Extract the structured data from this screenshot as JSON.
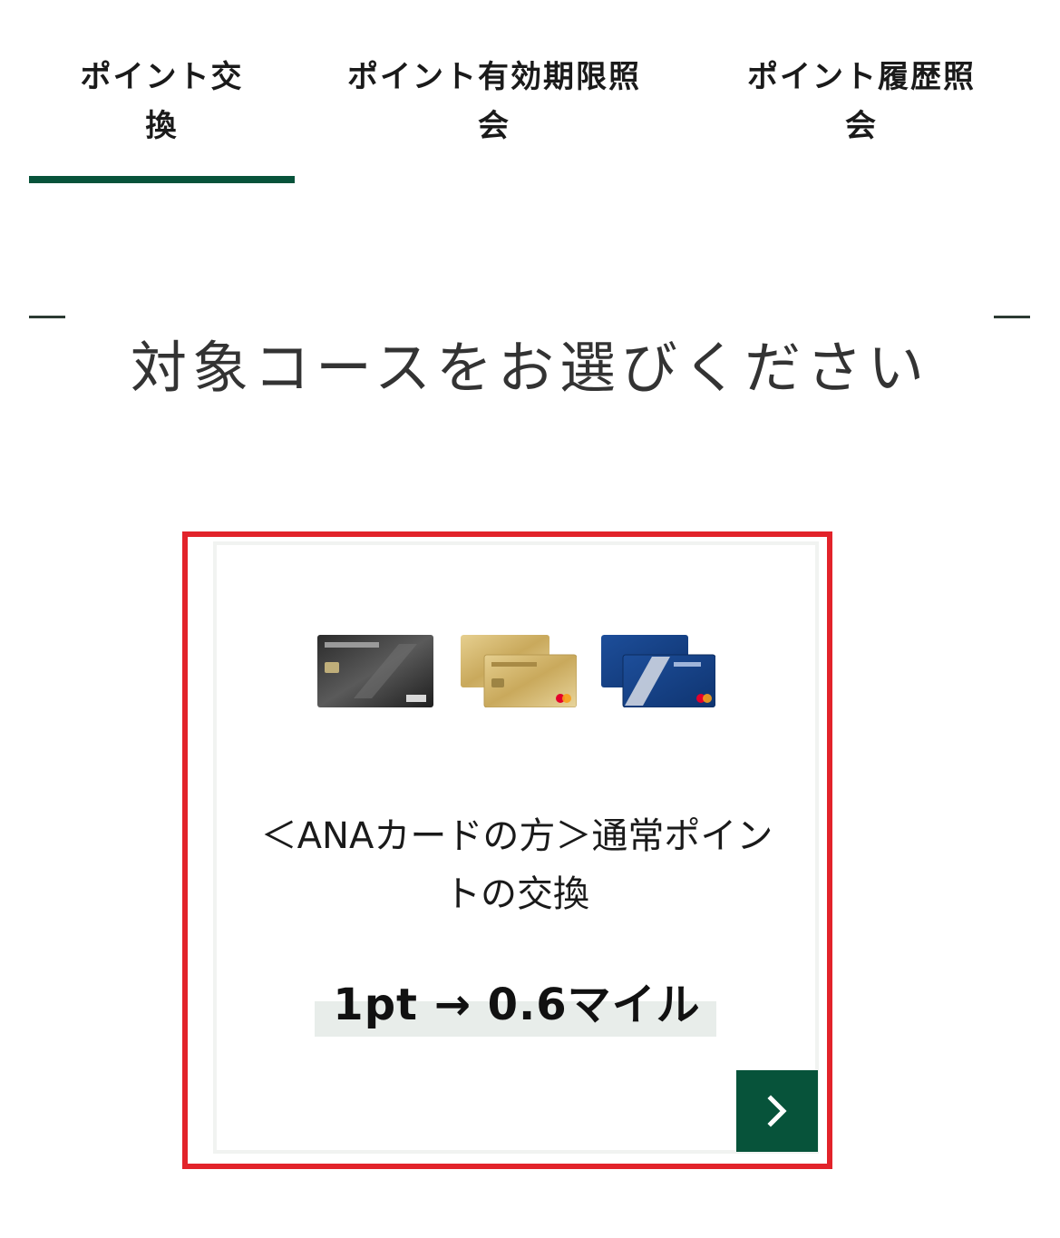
{
  "tabs": {
    "items": [
      {
        "line1": "ポイント交",
        "line2": "換"
      },
      {
        "line1": "ポイント有効期限照",
        "line2": "会"
      },
      {
        "line1": "ポイント履歴照",
        "line2": "会"
      }
    ],
    "active_index": 0,
    "accent_color": "#07533a"
  },
  "heading": "対象コースをお選びください",
  "card": {
    "images": [
      {
        "alt": "ANAカード（ブラック）",
        "icon": "card-black-icon"
      },
      {
        "alt": "ANAカード（ゴールド）",
        "icon": "card-gold-icon"
      },
      {
        "alt": "ANAカード（ブルー）",
        "icon": "card-blue-icon"
      }
    ],
    "title_line1": "＜ANAカードの方＞通常ポイン",
    "title_line2": "トの交換",
    "rate": "1pt → 0.6マイル",
    "button_icon": "chevron-right-icon",
    "highlight_color": "#e2232a"
  }
}
